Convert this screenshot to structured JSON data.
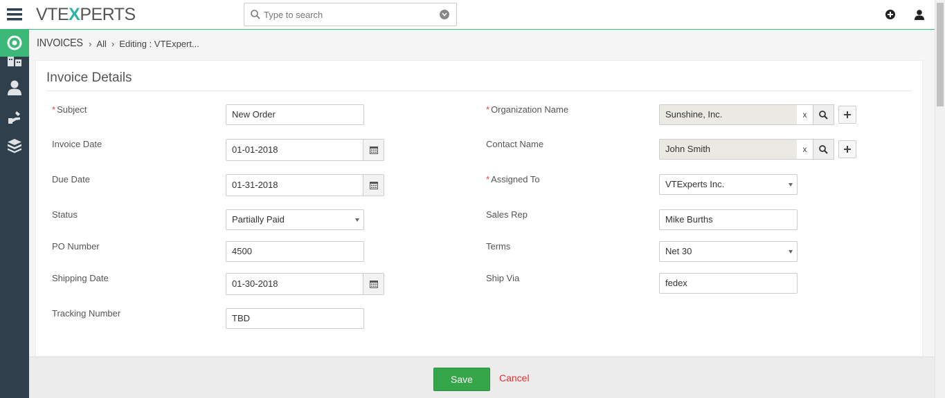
{
  "app": {
    "logo_prefix": "VTE",
    "logo_x": "X",
    "logo_suffix": "PERTS"
  },
  "search": {
    "placeholder": "Type to search"
  },
  "breadcrumb": {
    "module": "INVOICES",
    "items": [
      "All",
      "Editing : VTExpert..."
    ]
  },
  "form": {
    "title": "Invoice Details",
    "left": [
      {
        "label": "Subject",
        "required": "*",
        "value": "New Order"
      },
      {
        "label": "Invoice Date",
        "value": "01-01-2018"
      },
      {
        "label": "Due Date",
        "value": "01-31-2018"
      },
      {
        "label": "Status",
        "value": "Partially Paid"
      },
      {
        "label": "PO Number",
        "value": "4500"
      },
      {
        "label": "Shipping Date",
        "value": "01-30-2018"
      },
      {
        "label": "Tracking Number",
        "value": "TBD"
      }
    ],
    "right": [
      {
        "label": "Organization Name",
        "required": "*",
        "value": "Sunshine, Inc.",
        "clear": "x"
      },
      {
        "label": "Contact Name",
        "value": "John Smith",
        "clear": "x"
      },
      {
        "label": "Assigned To",
        "required": "*",
        "value": "VTExperts Inc."
      },
      {
        "label": "Sales Rep",
        "value": "Mike Burths"
      },
      {
        "label": "Terms",
        "value": "Net 30"
      },
      {
        "label": "Ship Via",
        "value": "fedex"
      }
    ]
  },
  "footer": {
    "save_label": "Save",
    "cancel_label": "Cancel"
  },
  "icons": {
    "menu": "hamburger-icon",
    "active_module": "target-icon",
    "sidebar": [
      "building-icon",
      "user-icon",
      "tools-icon",
      "box-icon"
    ],
    "header": [
      "add-icon",
      "user-icon"
    ]
  },
  "colors": {
    "sidebar": "#2f3f4b",
    "accent_green": "#3cb878",
    "save_button": "#35a64a",
    "cancel_link": "#e03030",
    "required_star": "#e04040"
  }
}
